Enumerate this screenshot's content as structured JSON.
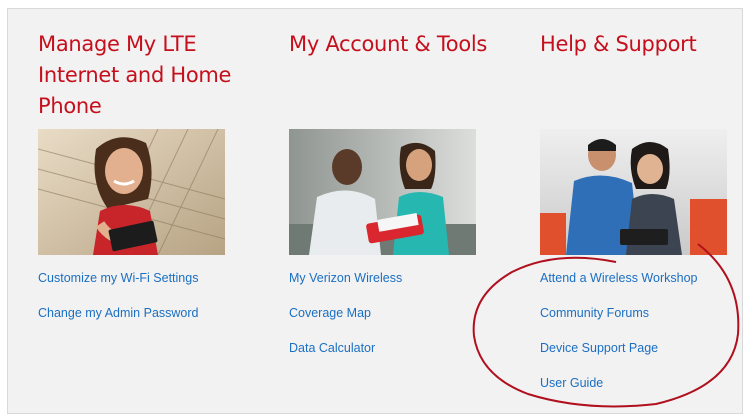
{
  "columns": [
    {
      "heading": "Manage My LTE Internet and Home Phone",
      "photo_icon": "woman-with-tablet-photo",
      "links": [
        "Customize my Wi-Fi Settings",
        "Change my Admin Password"
      ]
    },
    {
      "heading": "My Account & Tools",
      "photo_icon": "two-people-reviewing-tablet-photo",
      "links": [
        "My Verizon Wireless",
        "Coverage Map",
        "Data Calculator"
      ]
    },
    {
      "heading": "Help & Support",
      "photo_icon": "support-rep-helping-customer-photo",
      "links": [
        "Attend a Wireless Workshop",
        "Community Forums",
        "Device Support Page",
        "User Guide"
      ]
    }
  ],
  "colors": {
    "heading": "#c60f1c",
    "link": "#1b6fc2",
    "panel_background": "#f2f2f2",
    "annotation_ring": "#b0101e"
  }
}
